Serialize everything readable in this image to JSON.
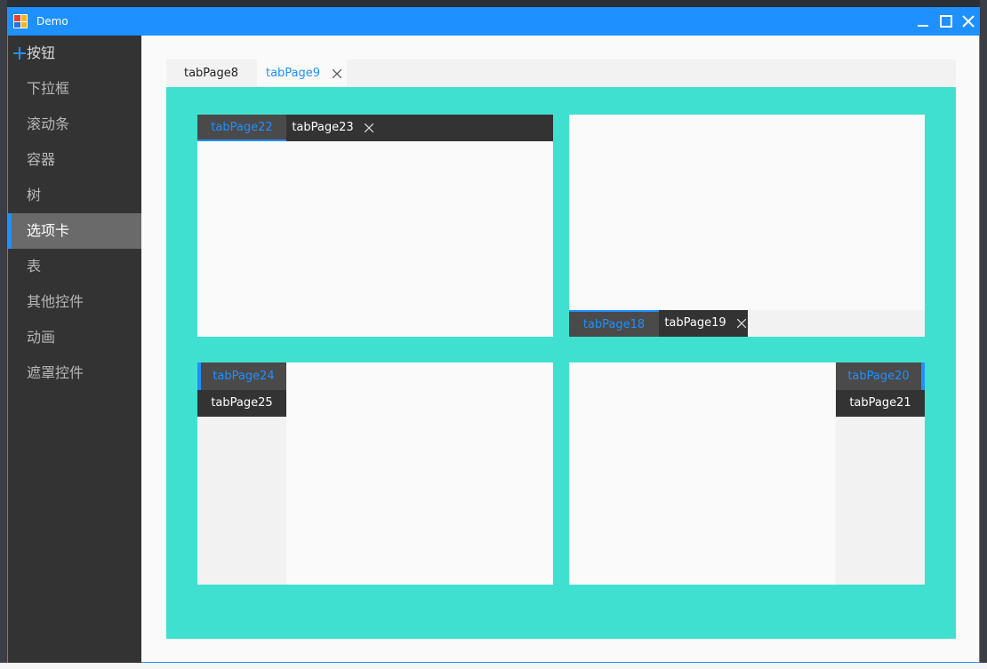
{
  "window": {
    "title": "Demo",
    "accent": "#1e90ff"
  },
  "sidebar": {
    "header": {
      "label": "按钮",
      "icon": "plus-icon"
    },
    "items": [
      {
        "label": "下拉框"
      },
      {
        "label": "滚动条"
      },
      {
        "label": "容器"
      },
      {
        "label": "树"
      },
      {
        "label": "选项卡",
        "active": true
      },
      {
        "label": "表"
      },
      {
        "label": "其他控件"
      },
      {
        "label": "动画"
      },
      {
        "label": "遮罩控件"
      }
    ]
  },
  "main_tabs": [
    {
      "label": "tabPage8"
    },
    {
      "label": "tabPage9",
      "active": true,
      "closable": true
    }
  ],
  "panels": {
    "top": {
      "tabs": [
        {
          "label": "tabPage22",
          "active": true
        },
        {
          "label": "tabPage23",
          "closable": true
        }
      ]
    },
    "bottom": {
      "tabs": [
        {
          "label": "tabPage18",
          "active": true
        },
        {
          "label": "tabPage19",
          "closable": true
        }
      ]
    },
    "left": {
      "tabs": [
        {
          "label": "tabPage24",
          "active": true
        },
        {
          "label": "tabPage25"
        }
      ]
    },
    "right": {
      "tabs": [
        {
          "label": "tabPage20",
          "active": true
        },
        {
          "label": "tabPage21"
        }
      ]
    }
  },
  "colors": {
    "titlebar": "#1e90ff",
    "sidebar": "#333333",
    "content_bg": "#40e0d0",
    "tab_active_text": "#1e90ff"
  }
}
